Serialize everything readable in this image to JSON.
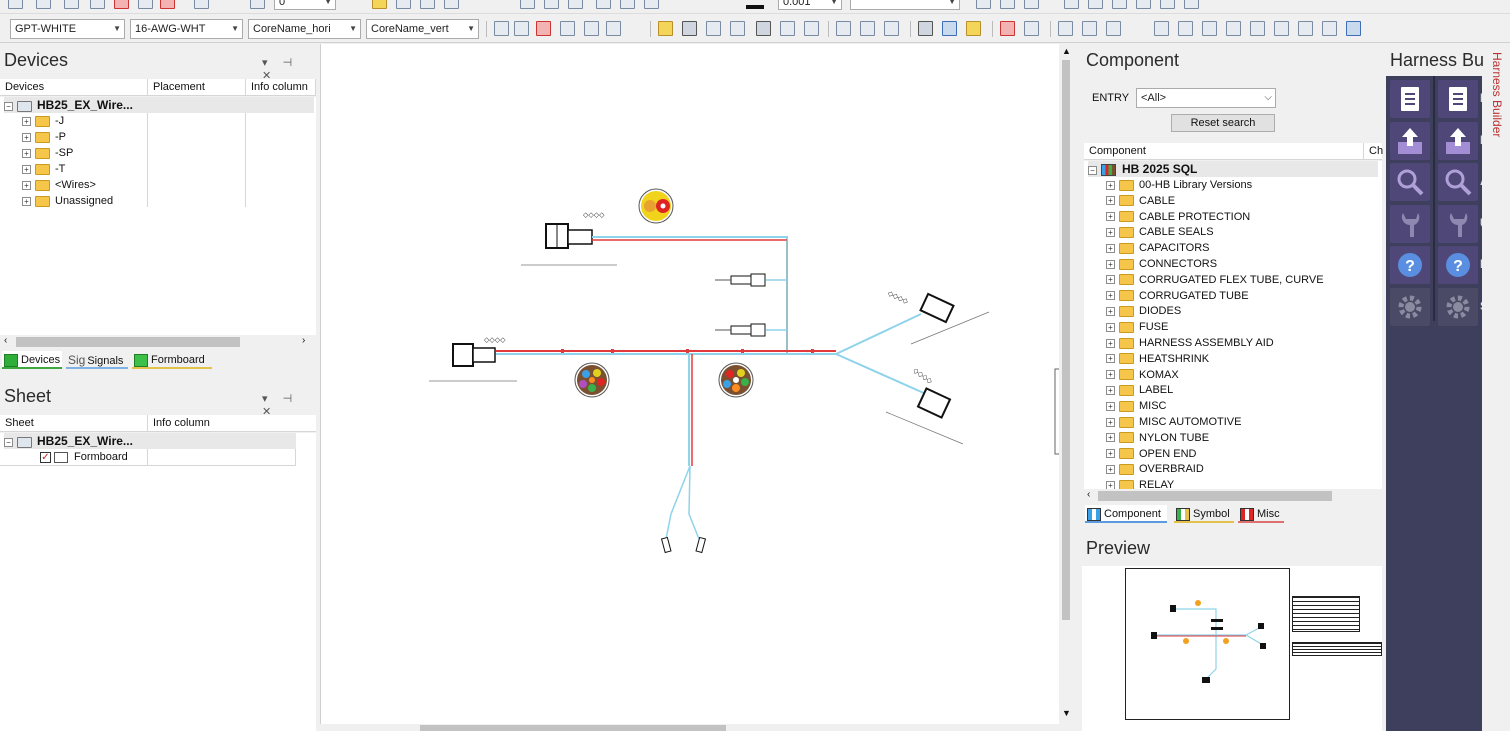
{
  "toolbar": {
    "combos": [
      {
        "value": "GPT-WHITE"
      },
      {
        "value": "16-AWG-WHT"
      },
      {
        "value": "CoreName_hori"
      },
      {
        "value": "CoreName_vert"
      }
    ],
    "top_values": [
      "0",
      "0.001"
    ]
  },
  "devices_panel": {
    "title": "Devices",
    "columns": [
      "Devices",
      "Placement",
      "Info column"
    ],
    "root": "HB25_EX_Wire...",
    "items": [
      "-J",
      "-P",
      "-SP",
      "-T",
      "<Wires>",
      "Unassigned"
    ],
    "tabs": [
      "Devices",
      "Signals",
      "Formboard"
    ]
  },
  "sheet_panel": {
    "title": "Sheet",
    "columns": [
      "Sheet",
      "Info column"
    ],
    "root": "HB25_EX_Wire...",
    "items": [
      "Formboard"
    ]
  },
  "component_panel": {
    "title": "Component",
    "entry_label": "ENTRY",
    "entry_value": "<All>",
    "reset_label": "Reset search",
    "columns": [
      "Component",
      "Ch"
    ],
    "root": "HB 2025 SQL",
    "items": [
      "00-HB Library Versions",
      "CABLE",
      "CABLE PROTECTION",
      "CABLE SEALS",
      "CAPACITORS",
      "CONNECTORS",
      "CORRUGATED FLEX TUBE, CURVE",
      "CORRUGATED TUBE",
      "DIODES",
      "FUSE",
      "HARNESS ASSEMBLY AID",
      "HEATSHRINK",
      "KOMAX",
      "LABEL",
      "MISC",
      "MISC AUTOMOTIVE",
      "NYLON TUBE",
      "OPEN END",
      "OVERBRAID",
      "RELAY"
    ],
    "tabs": [
      "Component",
      "Symbol",
      "Misc"
    ]
  },
  "preview_panel": {
    "title": "Preview"
  },
  "harness_panel": {
    "title": "Harness Bu",
    "vertical_tab": "Harness Builder",
    "cut_letters": [
      "F",
      "E",
      "A",
      "U",
      "H",
      "S"
    ]
  },
  "colors": {
    "wire_red": "#e23a3a",
    "wire_blue": "#8fd3ea",
    "harness_bg": "#3d3f5c",
    "button_purple": "#4f4778"
  }
}
